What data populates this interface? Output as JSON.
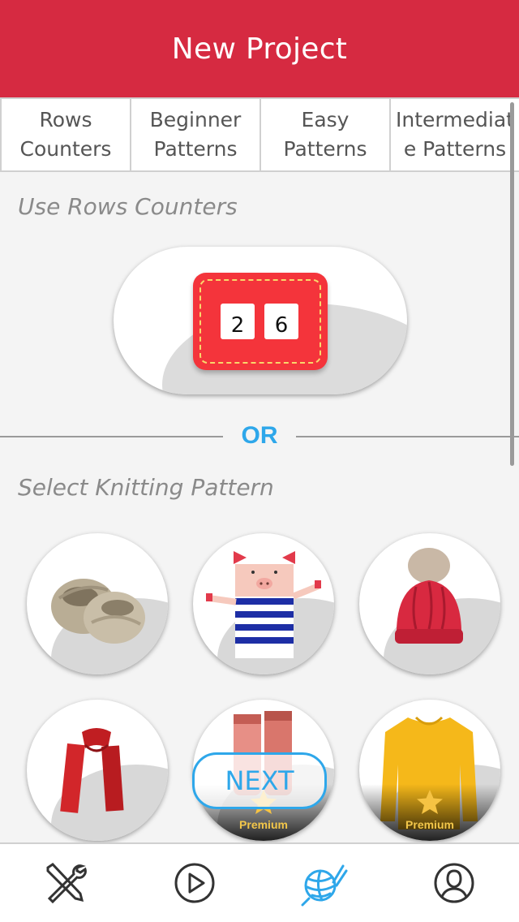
{
  "header": {
    "title": "New Project"
  },
  "tabs": [
    {
      "label": "Rows\nCounters"
    },
    {
      "label": "Beginner\nPatterns"
    },
    {
      "label": "Easy\nPatterns"
    },
    {
      "label": "Intermediat\ne Patterns"
    }
  ],
  "rows_section": {
    "label": "Use Rows Counters",
    "counter_digits": [
      "2",
      "6"
    ]
  },
  "divider": {
    "text": "OR"
  },
  "patterns_section": {
    "label": "Select Knitting Pattern",
    "items": [
      {
        "name": "booties",
        "premium": false
      },
      {
        "name": "pig-puppet",
        "premium": false
      },
      {
        "name": "pom-pom-hat",
        "premium": false
      },
      {
        "name": "scarf",
        "premium": false
      },
      {
        "name": "socks",
        "premium": true,
        "premium_label": "Premium"
      },
      {
        "name": "sweater",
        "premium": true,
        "premium_label": "Premium"
      }
    ]
  },
  "next_button": {
    "label": "NEXT"
  },
  "bottom_nav": {
    "items": [
      {
        "icon": "tools-icon",
        "active": false
      },
      {
        "icon": "play-icon",
        "active": false
      },
      {
        "icon": "yarn-icon",
        "active": true
      },
      {
        "icon": "profile-icon",
        "active": false
      }
    ]
  },
  "colors": {
    "brand": "#d62a41",
    "accent": "#2ea7ea",
    "counter": "#f4343b",
    "premium": "#f2c64a"
  }
}
